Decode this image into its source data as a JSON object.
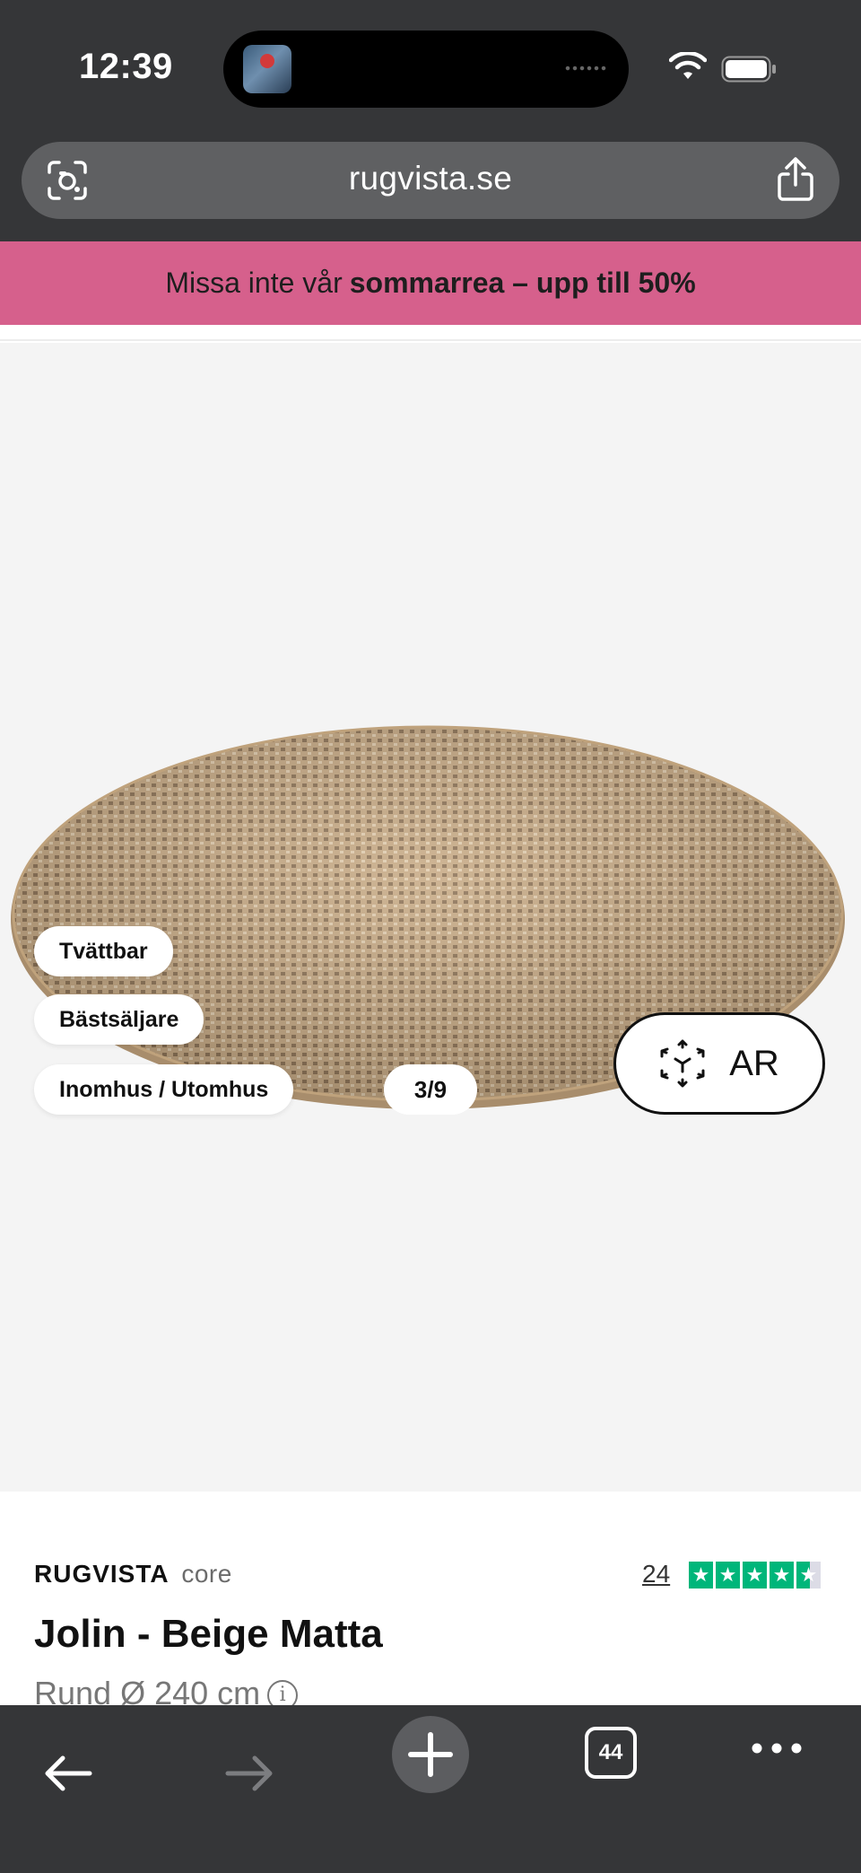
{
  "status_bar": {
    "time": "12:39"
  },
  "browser": {
    "url": "rugvista.se",
    "tab_count": "44"
  },
  "promo": {
    "text_regular": "Missa inte vår",
    "text_bold": "sommarrea – upp till 50%"
  },
  "gallery": {
    "tags": [
      "Tvättbar",
      "Bästsäljare",
      "Inomhus / Utomhus"
    ],
    "counter": "3/9",
    "ar_label": "AR"
  },
  "product": {
    "brand": "RUGVISTA",
    "brand_sub": "core",
    "review_count": "24",
    "rating_stars": 4.5,
    "title": "Jolin - Beige Matta",
    "size": "Rund Ø 240 cm",
    "info_glyph": "i"
  },
  "colors": {
    "promo_bg": "#d6608c",
    "chrome_bg": "#353638",
    "trustpilot_green": "#00b67a"
  },
  "icons": [
    "wifi-icon",
    "battery-icon",
    "camera-icon",
    "share-icon",
    "ar-cube-icon",
    "back-arrow-icon",
    "forward-arrow-icon",
    "plus-icon",
    "more-icon"
  ]
}
